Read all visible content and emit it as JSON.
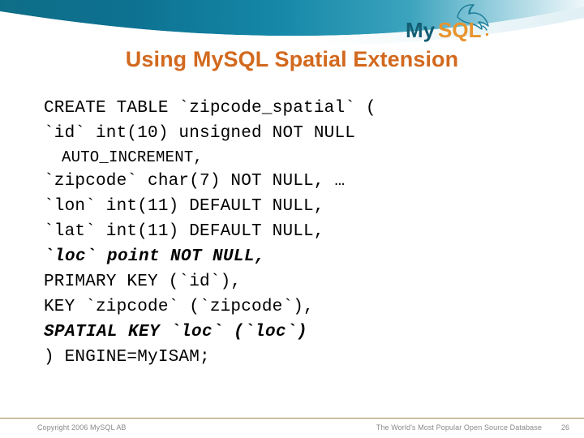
{
  "header": {
    "swoosh_color_dark": "#0b6f8c",
    "swoosh_color_light": "#bfe0ea",
    "logo": {
      "word_my": "My",
      "word_sql": "SQL",
      "trademark": ".",
      "my_color": "#135e73",
      "sql_color": "#e8942e",
      "dolphin_color": "#1f7f99",
      "icon_name": "mysql-dolphin-logo"
    }
  },
  "title": {
    "text": "Using MySQL Spatial Extension",
    "color": "#d2691e"
  },
  "code": {
    "lines": [
      {
        "text": "CREATE TABLE `zipcode_spatial` (",
        "style": "normal"
      },
      {
        "text": "`id` int(10) unsigned NOT NULL",
        "style": "normal"
      },
      {
        "text": "AUTO_INCREMENT,",
        "style": "indent"
      },
      {
        "text": "`zipcode` char(7) NOT NULL, …",
        "style": "normal"
      },
      {
        "text": "`lon` int(11) DEFAULT NULL,",
        "style": "normal"
      },
      {
        "text": "`lat` int(11) DEFAULT NULL,",
        "style": "normal"
      },
      {
        "text": "`loc` point NOT NULL,",
        "style": "emphasis"
      },
      {
        "text": "PRIMARY KEY (`id`),",
        "style": "normal"
      },
      {
        "text": "KEY `zipcode` (`zipcode`),",
        "style": "normal"
      },
      {
        "text": "SPATIAL KEY `loc` (`loc`)",
        "style": "emphasis"
      },
      {
        "text": ") ENGINE=MyISAM;",
        "style": "normal"
      }
    ]
  },
  "footer": {
    "copyright": "Copyright 2006 MySQL AB",
    "tagline": "The World's Most Popular Open Source Database",
    "page_number": "26",
    "rule_color": "#9b8850"
  }
}
